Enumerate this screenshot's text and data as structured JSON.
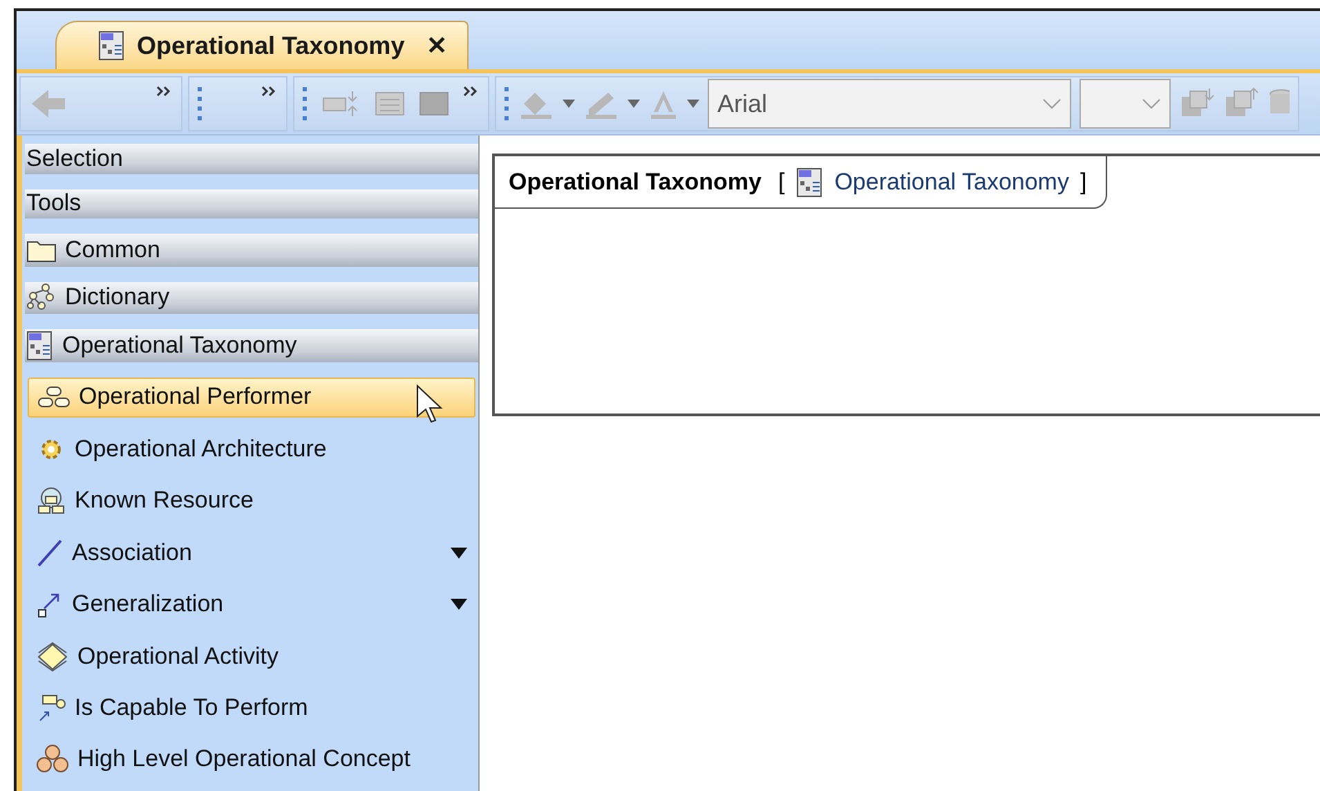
{
  "tab": {
    "title": "Operational Taxonomy",
    "close": "✕",
    "selected": true
  },
  "toolbar": {
    "font_field": {
      "value": "Arial"
    }
  },
  "palette": [
    {
      "kind": "section",
      "label": "Selection",
      "selected": false
    },
    {
      "kind": "section",
      "label": "Tools",
      "selected": false
    },
    {
      "kind": "group",
      "label": "Common",
      "selected": false
    },
    {
      "kind": "group",
      "label": "Dictionary",
      "selected": false
    },
    {
      "kind": "group",
      "label": "Operational Taxonomy",
      "selected": false
    },
    {
      "kind": "tool",
      "label": "Operational Performer",
      "selected": true,
      "menu": false
    },
    {
      "kind": "tool",
      "label": "Operational Architecture",
      "selected": false,
      "menu": false
    },
    {
      "kind": "tool",
      "label": "Known Resource",
      "selected": false,
      "menu": false
    },
    {
      "kind": "tool",
      "label": "Association",
      "selected": false,
      "menu": true
    },
    {
      "kind": "tool",
      "label": "Generalization",
      "selected": false,
      "menu": true
    },
    {
      "kind": "tool",
      "label": "Operational Activity",
      "selected": false,
      "menu": false
    },
    {
      "kind": "tool",
      "label": "Is Capable To Perform",
      "selected": false,
      "menu": false
    },
    {
      "kind": "tool",
      "label": "High Level Operational Concept",
      "selected": false,
      "menu": false
    }
  ],
  "diagram": {
    "name": "Operational Taxonomy",
    "open_bracket": "[",
    "type_label": "Operational Taxonomy",
    "close_bracket": "]"
  }
}
